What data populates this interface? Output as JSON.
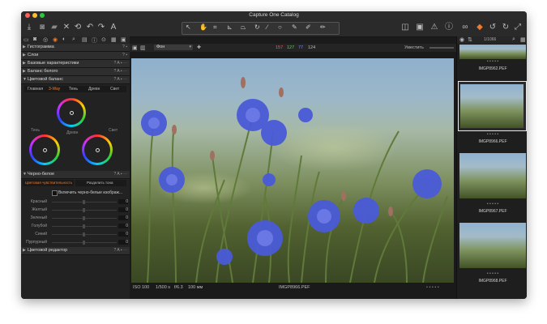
{
  "window": {
    "title": "Capture One Catalog",
    "traffic_colors": [
      "#ff5f57",
      "#ffbd2e",
      "#28c940"
    ]
  },
  "toolbar": {
    "left_icons": [
      "import-icon",
      "camera-icon",
      "folder-icon",
      "delete-icon",
      "reset-icon",
      "undo-icon",
      "redo-icon",
      "text-icon"
    ],
    "cursor_tools": [
      "pan-tool-icon",
      "hand-tool-icon",
      "crop-tool-icon",
      "straighten-tool-icon",
      "keystone-tool-icon",
      "rotate-tool-icon",
      "line-tool-icon",
      "circle-tool-icon",
      "brush-tool-icon",
      "picker-tool-icon",
      "annotate-tool-icon"
    ],
    "right_icons": [
      "edit-icon",
      "overlay-icon",
      "warning-icon",
      "info-icon",
      "glasses-icon",
      "color-icon",
      "rotate-left-icon",
      "rotate-right-icon",
      "expand-icon"
    ]
  },
  "left_panel": {
    "sections": [
      {
        "name": "Гистограмма",
        "collapsed": true
      },
      {
        "name": "Слои",
        "collapsed": true
      },
      {
        "name": "Базовые характеристики",
        "collapsed": true
      },
      {
        "name": "Баланс белого",
        "collapsed": true
      },
      {
        "name": "Цветовой баланс",
        "collapsed": false
      }
    ],
    "color_balance": {
      "tabs": [
        "Главная",
        "3-Way",
        "Тень",
        "Древн",
        "Свет"
      ],
      "active_tab": "3-Way",
      "labels": {
        "shadow": "Тень",
        "mid": "Древн",
        "light": "Свет"
      }
    },
    "bw": {
      "title": "Черно-белое",
      "tabs": [
        "Цветовая чувствительность",
        "Разделить тона"
      ],
      "active_tab": "Цветовая чувствительность",
      "checkbox_label": "Включить черно-белые изображ...",
      "sliders": [
        {
          "label": "Красный",
          "value": "0"
        },
        {
          "label": "Желтый",
          "value": "0"
        },
        {
          "label": "Зеленый",
          "value": "0"
        },
        {
          "label": "Голубой",
          "value": "0"
        },
        {
          "label": "Синий",
          "value": "0"
        },
        {
          "label": "Пурпурный",
          "value": "0"
        }
      ]
    },
    "color_editor": {
      "title": "Цветовой редактор"
    }
  },
  "viewer": {
    "dropdown": "Фон",
    "readout": {
      "r": "157",
      "g": "127",
      "b": "77",
      "l": "124"
    },
    "zoom_label": "Уместить",
    "counter": "1/1066",
    "status": {
      "iso": "ISO 100",
      "shutter": "1/500 s",
      "aperture": "f/6.3",
      "focal": "100 мм",
      "filename": "IMGP8966.PEF",
      "stars": "• • • • •"
    }
  },
  "browser": {
    "stars": "• • • • •",
    "thumbs": [
      {
        "filename": "IMGP8962.PEF",
        "selected": false
      },
      {
        "filename": "IMGP8966.PEF",
        "selected": true
      },
      {
        "filename": "IMGP8967.PEF",
        "selected": false
      },
      {
        "filename": "IMGP8968.PEF",
        "selected": false
      }
    ]
  }
}
